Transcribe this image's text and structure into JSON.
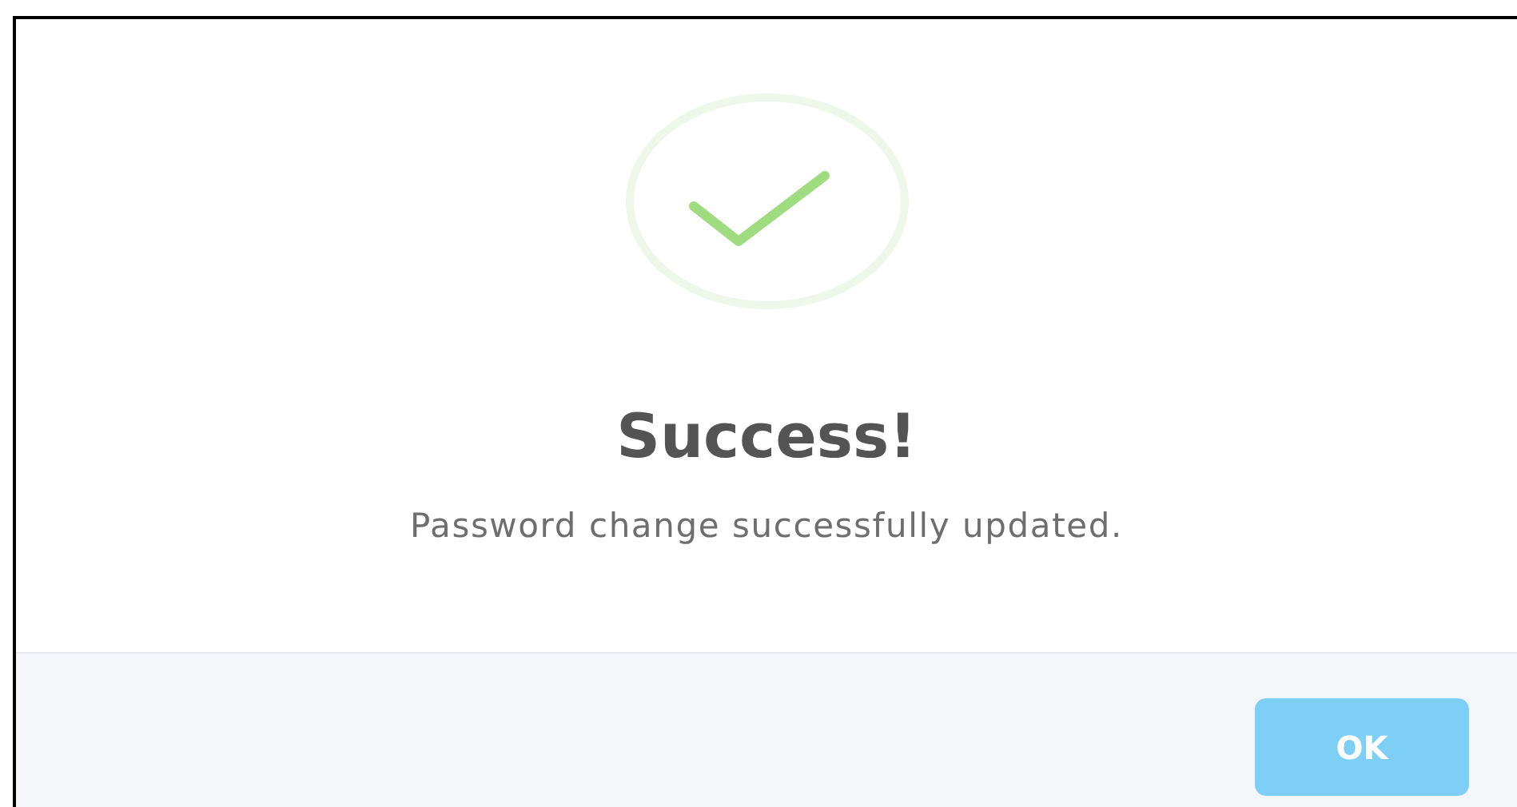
{
  "dialog": {
    "title": "Success!",
    "message": "Password change successfully updated.",
    "buttons": [
      {
        "label": "OK",
        "disabled": true
      }
    ]
  }
}
